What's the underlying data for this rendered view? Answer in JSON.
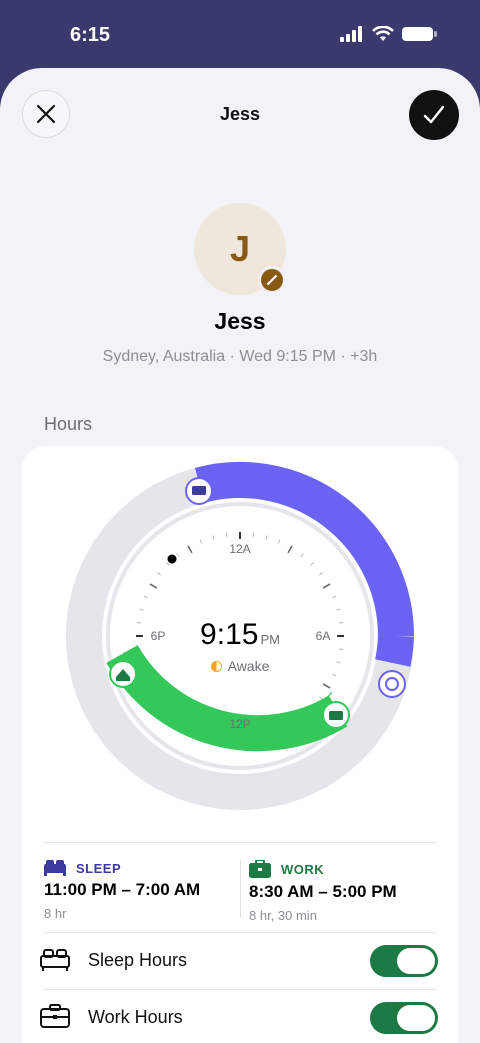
{
  "status_bar": {
    "time": "6:15"
  },
  "nav": {
    "title": "Jess"
  },
  "profile": {
    "initial": "J",
    "name": "Jess",
    "subtitle": "Sydney, Australia · Wed 9:15 PM · +3h"
  },
  "hours": {
    "section_title": "Hours",
    "clock": {
      "time": "9:15",
      "meridiem": "PM",
      "state": "Awake",
      "labels": {
        "top": "12A",
        "right": "6A",
        "bottom": "12P",
        "left": "6P"
      }
    },
    "sleep": {
      "label": "SLEEP",
      "range": "11:00 PM – 7:00 AM",
      "duration": "8 hr",
      "color": "#3d3a9e"
    },
    "work": {
      "label": "WORK",
      "range": "8:30 AM – 5:00 PM",
      "duration": "8 hr, 30 min",
      "color": "#1e7a45"
    }
  },
  "toggles": [
    {
      "label": "Sleep Hours",
      "on": true,
      "icon": "bed-icon"
    },
    {
      "label": "Work Hours",
      "on": true,
      "icon": "briefcase-icon"
    }
  ],
  "colors": {
    "sleep_arc": "#6b63f5",
    "work_arc": "#34c759",
    "toggle_on": "#1e7a45"
  }
}
